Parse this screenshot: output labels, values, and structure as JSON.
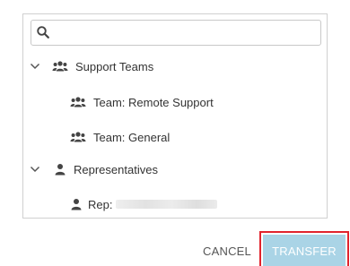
{
  "search": {
    "value": "",
    "placeholder": "",
    "icon": "search-icon"
  },
  "tree": {
    "support_teams": {
      "label": "Support Teams",
      "expanded": true,
      "icon": "users-group-icon",
      "children": [
        {
          "label": "Team: Remote Support",
          "icon": "users-group-icon"
        },
        {
          "label": "Team: General",
          "icon": "users-group-icon"
        }
      ]
    },
    "representatives": {
      "label": "Representatives",
      "expanded": true,
      "icon": "user-icon",
      "children": [
        {
          "label": "Rep:",
          "icon": "user-icon",
          "name_redacted": true
        }
      ]
    }
  },
  "footer": {
    "cancel_label": "CANCEL",
    "transfer_label": "TRANSFER"
  },
  "colors": {
    "text": "#333333",
    "border": "#d0d0d0",
    "transfer_bg": "#aad4e6",
    "highlight": "#e1232d"
  }
}
